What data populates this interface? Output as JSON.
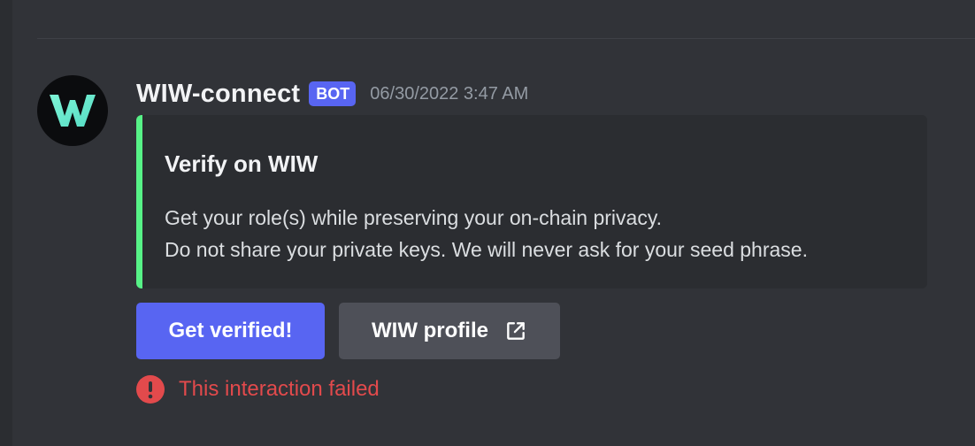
{
  "message": {
    "avatar": {
      "letter": "W",
      "icon": "wiw-logo"
    },
    "username": "WIW-connect",
    "badge": "BOT",
    "timestamp": "06/30/2022 3:47 AM"
  },
  "embed": {
    "accent_color": "#57f287",
    "title": "Verify on WIW",
    "description_lines": [
      "Get your role(s) while preserving your on-chain privacy.",
      "Do not share your private keys. We will never ask for your seed phrase."
    ]
  },
  "buttons": {
    "primary": {
      "label": "Get verified!",
      "color": "#5865f2"
    },
    "secondary": {
      "label": "WIW profile",
      "icon": "external-link-icon",
      "color": "#4e5058"
    }
  },
  "error": {
    "icon": "exclamation-circle-icon",
    "text": "This interaction failed",
    "color": "#e24a4c"
  }
}
